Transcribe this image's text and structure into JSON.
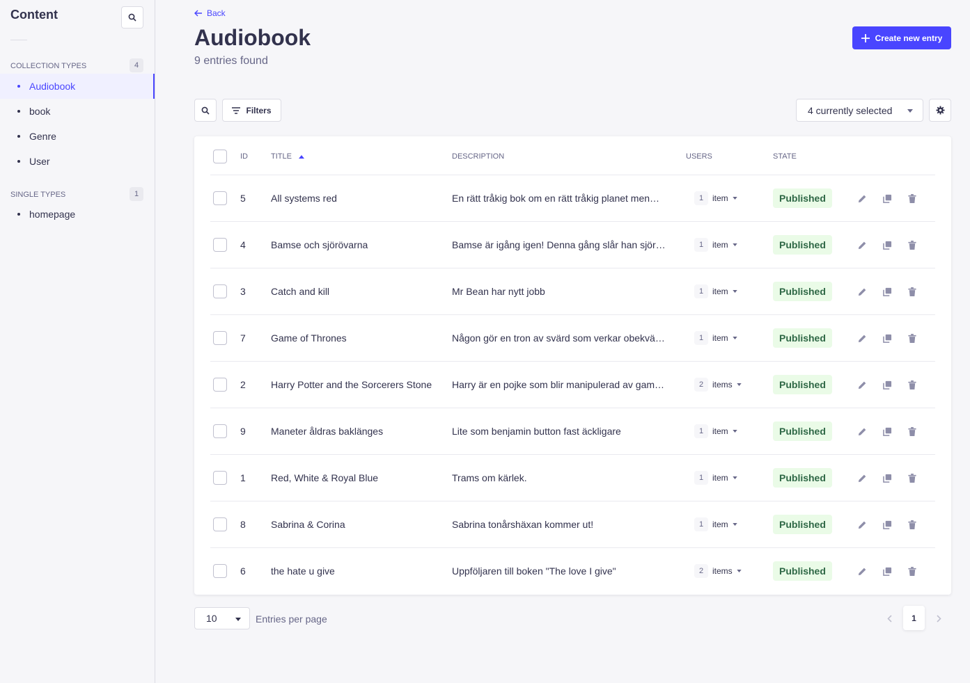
{
  "sidebar": {
    "title": "Content",
    "collection_types": {
      "label": "COLLECTION TYPES",
      "count": "4",
      "items": [
        {
          "label": "Audiobook"
        },
        {
          "label": "book"
        },
        {
          "label": "Genre"
        },
        {
          "label": "User"
        }
      ]
    },
    "single_types": {
      "label": "SINGLE TYPES",
      "count": "1",
      "items": [
        {
          "label": "homepage"
        }
      ]
    },
    "active_item": "Audiobook"
  },
  "header": {
    "back_label": "Back",
    "title": "Audiobook",
    "subtitle": "9 entries found",
    "create_label": "Create new entry"
  },
  "toolbar": {
    "filters_label": "Filters",
    "columns_select": "4 currently selected"
  },
  "table": {
    "columns": {
      "id": "ID",
      "title": "TITLE",
      "description": "DESCRIPTION",
      "users": "USERS",
      "state": "STATE"
    },
    "sort": {
      "column": "TITLE",
      "direction": "asc"
    },
    "rows": [
      {
        "id": "5",
        "title": "All systems red",
        "description": "En rätt tråkig bok om en rätt tråkig planet men…",
        "users_count": "1",
        "users_unit": "item",
        "state": "Published"
      },
      {
        "id": "4",
        "title": "Bamse och sjörövarna",
        "description": "Bamse är igång igen! Denna gång slår han sjör…",
        "users_count": "1",
        "users_unit": "item",
        "state": "Published"
      },
      {
        "id": "3",
        "title": "Catch and kill",
        "description": "Mr Bean har nytt jobb",
        "users_count": "1",
        "users_unit": "item",
        "state": "Published"
      },
      {
        "id": "7",
        "title": "Game of Thrones",
        "description": "Någon gör en tron av svärd som verkar obekvä…",
        "users_count": "1",
        "users_unit": "item",
        "state": "Published"
      },
      {
        "id": "2",
        "title": "Harry Potter and the Sorcerers Stone",
        "description": "Harry är en pojke som blir manipulerad av gam…",
        "users_count": "2",
        "users_unit": "items",
        "state": "Published"
      },
      {
        "id": "9",
        "title": "Maneter åldras baklänges",
        "description": "Lite som benjamin button fast äckligare",
        "users_count": "1",
        "users_unit": "item",
        "state": "Published"
      },
      {
        "id": "1",
        "title": "Red, White & Royal Blue",
        "description": "Trams om kärlek.",
        "users_count": "1",
        "users_unit": "item",
        "state": "Published"
      },
      {
        "id": "8",
        "title": "Sabrina & Corina",
        "description": "Sabrina tonårshäxan kommer ut!",
        "users_count": "1",
        "users_unit": "item",
        "state": "Published"
      },
      {
        "id": "6",
        "title": "the hate u give",
        "description": "Uppföljaren till boken \"The love I give\"",
        "users_count": "2",
        "users_unit": "items",
        "state": "Published"
      }
    ]
  },
  "footer": {
    "per_page_value": "10",
    "per_page_label": "Entries per page",
    "current_page": "1"
  },
  "colors": {
    "accent": "#4945ff",
    "published_bg": "#eafbe7",
    "published_text": "#2f6846"
  }
}
